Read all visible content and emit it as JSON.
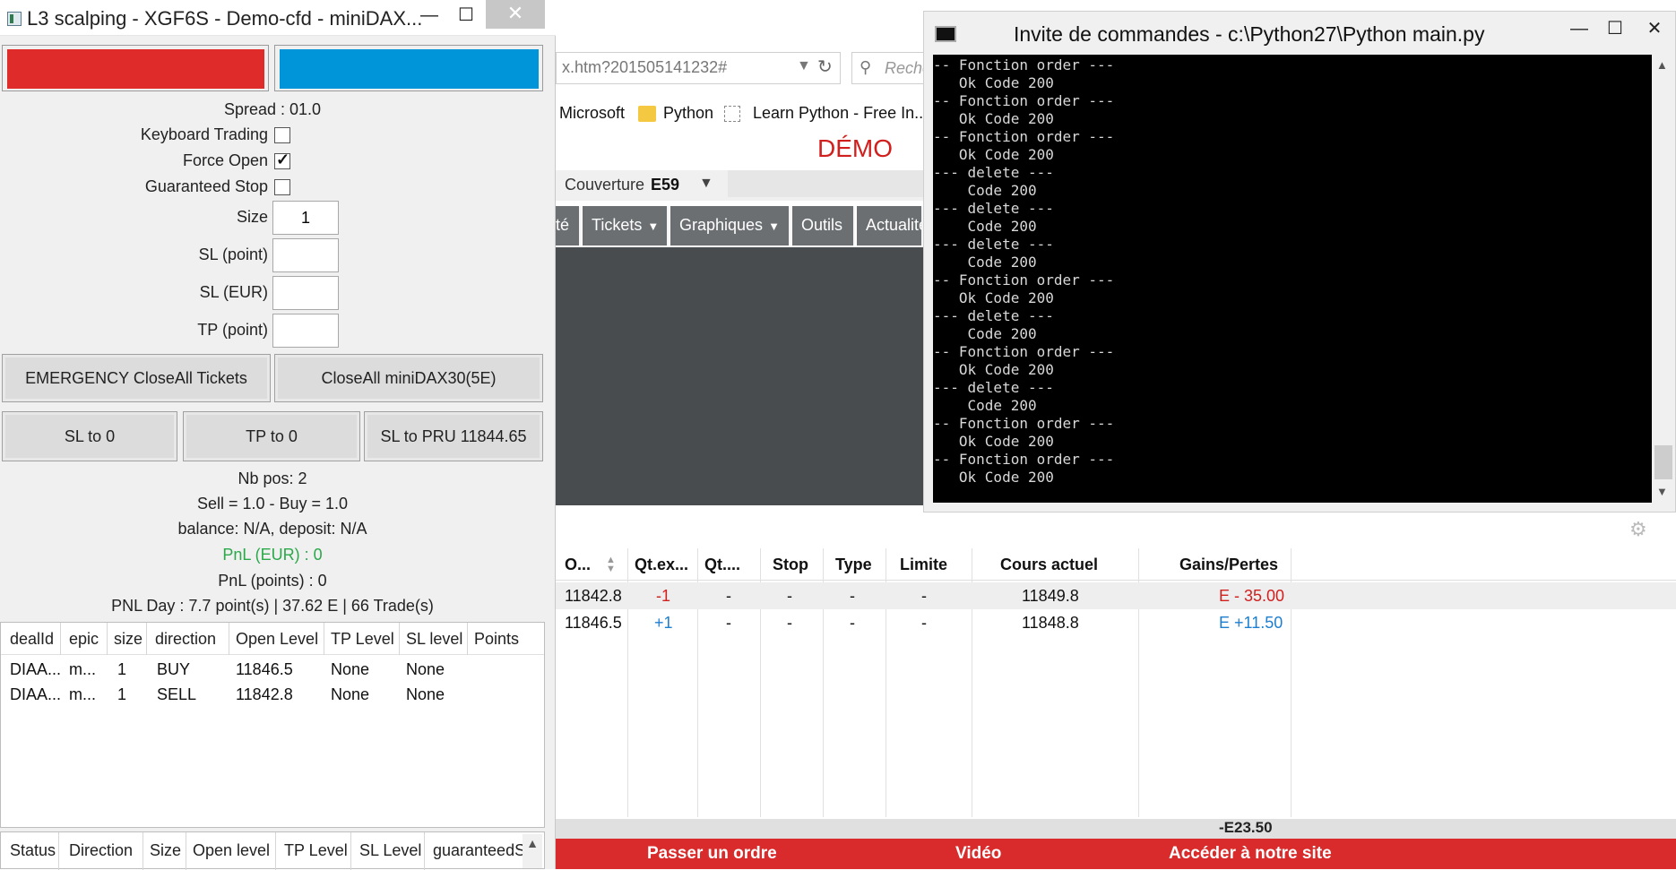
{
  "l3": {
    "title": "L3 scalping - XGF6S - Demo-cfd - miniDAX...",
    "controls": {
      "minimize": "—",
      "maximize": "☐",
      "close": "✕"
    },
    "spread": "Spread : 01.0",
    "keyboard_trading": "Keyboard Trading",
    "force_open": "Force Open",
    "guaranteed_stop": "Guaranteed Stop",
    "size_label": "Size",
    "size_value": "1",
    "sl_point_label": "SL (point)",
    "sl_eur_label": "SL (EUR)",
    "tp_point_label": "TP (point)",
    "emergency_btn": "EMERGENCY CloseAll Tickets",
    "closeall_btn": "CloseAll miniDAX30(5E)",
    "sl_to_0": "SL to 0",
    "tp_to_0": "TP to 0",
    "sl_to_pru": "SL to PRU 11844.65",
    "nb_pos": "Nb pos: 2",
    "sell_buy": "Sell = 1.0 - Buy = 1.0",
    "balance": "balance: N/A, deposit: N/A",
    "pnl_eur": "PnL (EUR) : 0",
    "pnl_points": "PnL (points) : 0",
    "pnl_day": "PNL Day : 7.7 point(s) | 37.62 E | 66 Trade(s)",
    "table": {
      "headers": [
        "dealId",
        "epic",
        "size",
        "direction",
        "Open Level",
        "TP Level",
        "SL level",
        "Points"
      ],
      "rows": [
        [
          "DIAA...",
          "m...",
          "1",
          "BUY",
          "11846.5",
          "None",
          "None",
          ""
        ],
        [
          "DIAA...",
          "m...",
          "1",
          "SELL",
          "11842.8",
          "None",
          "None",
          ""
        ]
      ]
    },
    "table2": {
      "headers": [
        "Status",
        "Direction",
        "Size",
        "Open level",
        "TP Level",
        "SL Level",
        "guaranteedS"
      ]
    },
    "colors": {
      "sell": "#e02b2b",
      "buy": "#0095d9",
      "pnl_eur": "#2aa84a"
    }
  },
  "browser": {
    "address": "x.htm?201505141232#",
    "search_placeholder": "Reche",
    "bookmarks": [
      "Microsoft",
      "Python",
      "Learn Python - Free In..."
    ],
    "demo": "DÉMO",
    "couverture_label": "Couverture",
    "couverture_code": "E59",
    "nav": [
      "té",
      "Tickets",
      "Graphiques",
      "Outils",
      "Actualité"
    ]
  },
  "console": {
    "title": "Invite de commandes - c:\\Python27\\Python  main.py",
    "lines": [
      "-- Fonction order ---",
      "   Ok Code 200",
      "-- Fonction order ---",
      "   Ok Code 200",
      "-- Fonction order ---",
      "   Ok Code 200",
      "--- delete ---",
      "    Code 200",
      "--- delete ---",
      "    Code 200",
      "--- delete ---",
      "    Code 200",
      "-- Fonction order ---",
      "   Ok Code 200",
      "--- delete ---",
      "    Code 200",
      "-- Fonction order ---",
      "   Ok Code 200",
      "--- delete ---",
      "    Code 200",
      "-- Fonction order ---",
      "   Ok Code 200",
      "-- Fonction order ---",
      "   Ok Code 200"
    ]
  },
  "positions": {
    "headers": [
      "O...",
      "Qt.ex...",
      "Qt....",
      "Stop",
      "Type",
      "Limite",
      "Cours actuel",
      "Gains/Pertes"
    ],
    "rows": [
      [
        "11842.8",
        "-1",
        "-",
        "-",
        "-",
        "-",
        "11849.8",
        "E - 35.00"
      ],
      [
        "11846.5",
        "+1",
        "-",
        "-",
        "-",
        "-",
        "11848.8",
        "E +11.50"
      ]
    ],
    "total": "-E23.50",
    "footer": [
      "Passer un ordre",
      "Vidéo",
      "Accéder à notre site"
    ],
    "colors": {
      "loss": "#d0201e",
      "gain": "#1e7fd0"
    }
  }
}
